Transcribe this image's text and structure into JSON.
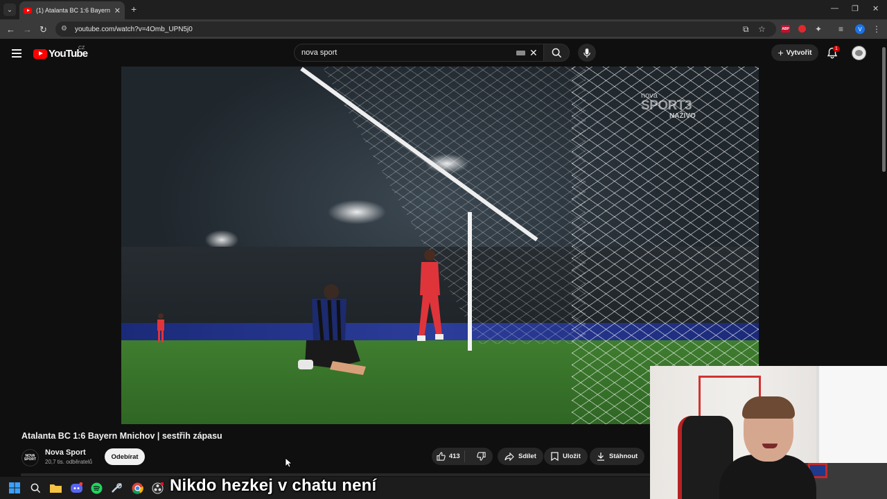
{
  "browser": {
    "tab_title": "(1) Atalanta BC 1:6 Bayern Mnichov | sestřih zápasu - YouTube",
    "tab_close": "✕",
    "new_tab": "+",
    "url": "youtube.com/watch?v=4Omb_UPN5j0",
    "profile_initial": "V",
    "adblock_label": "ABP",
    "window_controls": {
      "minimize": "—",
      "maximize": "❐",
      "close": "✕"
    }
  },
  "masthead": {
    "logo_text": "YouTube",
    "country_code": "CZ",
    "search_value": "nova sport",
    "create_label": "Vytvořit",
    "notification_count": "1"
  },
  "video": {
    "title": "Atalanta BC 1:6 Bayern Mnichov | sestřih zápasu",
    "broadcaster_nova": "nova",
    "broadcaster_sport": "SPORT3",
    "broadcaster_live": "NAŽIVO"
  },
  "channel": {
    "avatar_line1": "NOVA",
    "avatar_line2": "SPORT",
    "name": "Nova Sport",
    "subscribers": "20,7 tis. odběratelů",
    "subscribe_label": "Odebírat"
  },
  "actions": {
    "like_count": "413",
    "share_label": "Sdílet",
    "save_label": "Uložit",
    "download_label": "Stáhnout"
  },
  "overlay": {
    "caption": "Nikdo hezkej v chatu není"
  },
  "colors": {
    "yt_red": "#ff0000",
    "background": "#0f0f0f",
    "pill": "#272727"
  }
}
